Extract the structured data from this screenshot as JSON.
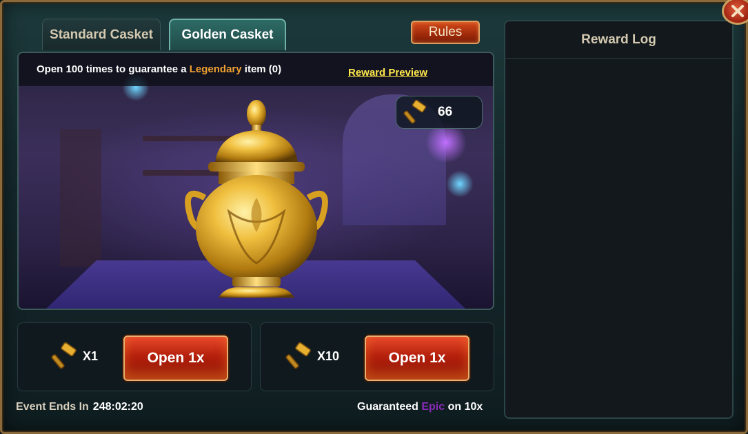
{
  "tabs": [
    {
      "label": "Standard Casket",
      "active": false
    },
    {
      "label": "Golden Casket",
      "active": true
    }
  ],
  "rules_label": "Rules",
  "banner": {
    "prefix": "Open 100 times to guarantee a ",
    "highlight": "Legendary",
    "suffix": " item (0)",
    "reward_preview": "Reward Preview"
  },
  "currency": {
    "icon": "hammer-icon",
    "amount": "66"
  },
  "open_options": [
    {
      "cost_icon": "hammer-icon",
      "cost_label": "X1",
      "button_label": "Open 1x"
    },
    {
      "cost_icon": "hammer-icon",
      "cost_label": "X10",
      "button_label": "Open 1x"
    }
  ],
  "event": {
    "label": "Event Ends In",
    "time": "248:02:20"
  },
  "guarantee": {
    "prefix": "Guaranteed ",
    "highlight": "Epic",
    "suffix": " on 10x"
  },
  "reward_log": {
    "title": "Reward Log"
  },
  "colors": {
    "legendary": "#f0a030",
    "epic": "#8a2ab8",
    "reward_preview": "#ffe84a"
  }
}
